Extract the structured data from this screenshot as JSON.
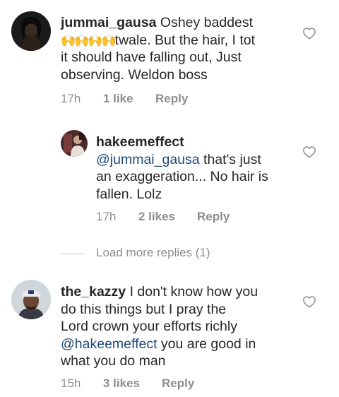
{
  "comments": [
    {
      "username": "jummai_gausa",
      "text_line1": "Oshey baddest",
      "emoji": "🙌🙌🙌🙌",
      "text_line2_rest": "twale.  But the hair,  I tot",
      "text_line3": "it should have falling out,  Just",
      "text_line4": "observing. Weldon boss",
      "time": "17h",
      "likes": "1 like",
      "reply_label": "Reply"
    },
    {
      "username": "hakeemeffect",
      "mention": "@jummai_gausa",
      "text_line1_rest": " that's just",
      "text_line2": "an exaggeration... No hair is",
      "text_line3": "fallen.  Lolz",
      "time": "17h",
      "likes": "2 likes",
      "reply_label": "Reply"
    },
    {
      "username": "the_kazzy",
      "text_line1": "I don't know how you",
      "text_line2": "do this things but I pray the",
      "text_line3": "Lord crown your efforts richly",
      "mention": "@hakeemeffect",
      "text_line4_rest": " you are good in",
      "text_line5": "what you do man",
      "time": "15h",
      "likes": "3 likes",
      "reply_label": "Reply"
    }
  ],
  "load_more": "Load more replies (1)",
  "icons": {
    "like": "heart-outline-icon"
  },
  "colors": {
    "text": "#262626",
    "meta": "#8e8e8e",
    "mention": "#1f4a7a",
    "heart": "#8e8e8e"
  }
}
